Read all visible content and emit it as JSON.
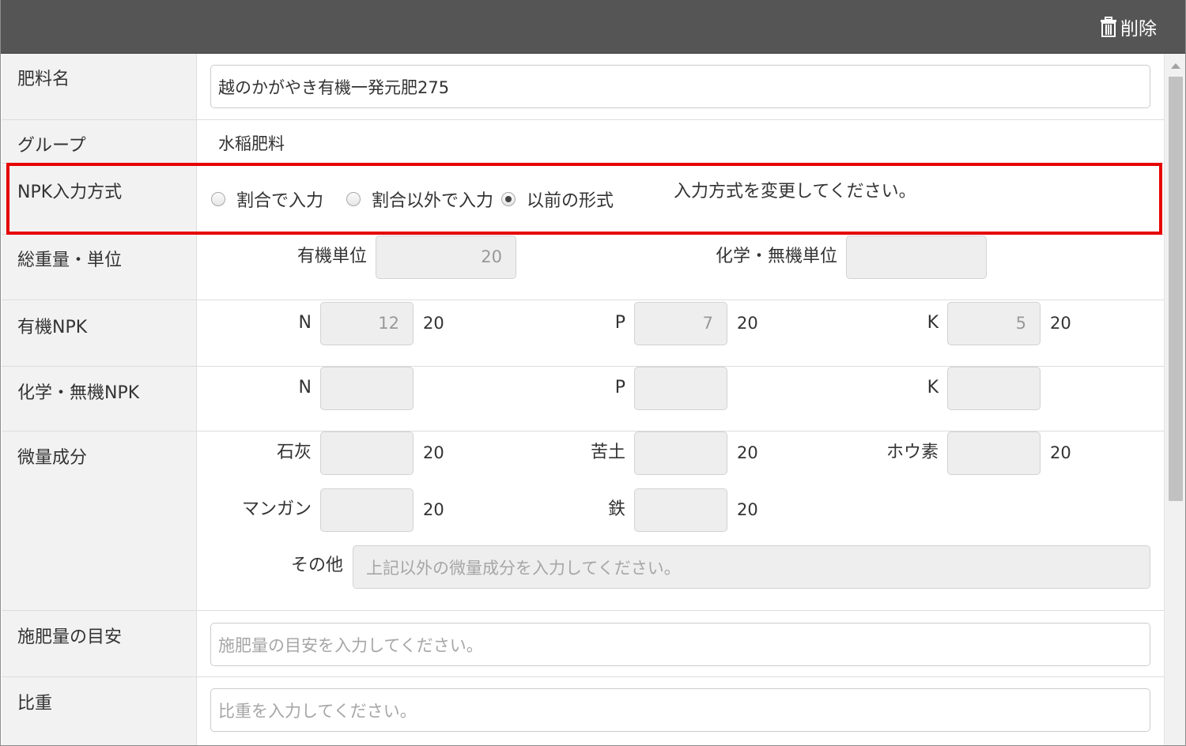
{
  "toolbar": {
    "delete_label": "削除",
    "delete_icon": "trash-icon"
  },
  "form": {
    "fertilizer_name": {
      "label": "肥料名",
      "value": "越のかがやき有機一発元肥275"
    },
    "group": {
      "label": "グループ",
      "value": "水稲肥料"
    },
    "npk_method": {
      "label": "NPK入力方式",
      "options": [
        "割合で入力",
        "割合以外で入力",
        "以前の形式"
      ],
      "selected": "以前の形式",
      "note": "入力方式を変更してください。"
    },
    "total_weight": {
      "label": "総重量・単位",
      "organic_label": "有機単位",
      "organic_value": "20",
      "chemical_label": "化学・無機単位",
      "chemical_value": ""
    },
    "organic_npk": {
      "label": "有機NPK",
      "n_label": "N",
      "n_value": "12",
      "n_unit": "20",
      "p_label": "P",
      "p_value": "7",
      "p_unit": "20",
      "k_label": "K",
      "k_value": "5",
      "k_unit": "20"
    },
    "chemical_npk": {
      "label": "化学・無機NPK",
      "n_label": "N",
      "n_value": "",
      "p_label": "P",
      "p_value": "",
      "k_label": "K",
      "k_value": ""
    },
    "trace": {
      "label": "微量成分",
      "lime_label": "石灰",
      "lime_unit": "20",
      "bitter_label": "苦土",
      "bitter_unit": "20",
      "boron_label": "ホウ素",
      "boron_unit": "20",
      "manganese_label": "マンガン",
      "manganese_unit": "20",
      "iron_label": "鉄",
      "iron_unit": "20",
      "other_label": "その他",
      "other_placeholder": "上記以外の微量成分を入力してください。"
    },
    "application_guide": {
      "label": "施肥量の目安",
      "placeholder": "施肥量の目安を入力してください。"
    },
    "specific_gravity": {
      "label": "比重",
      "placeholder": "比重を入力してください。"
    }
  },
  "colors": {
    "header_bg": "#555555",
    "label_bg": "#f2f2f2",
    "highlight": "#e60000",
    "disabled_input_bg": "#eeeeee"
  }
}
